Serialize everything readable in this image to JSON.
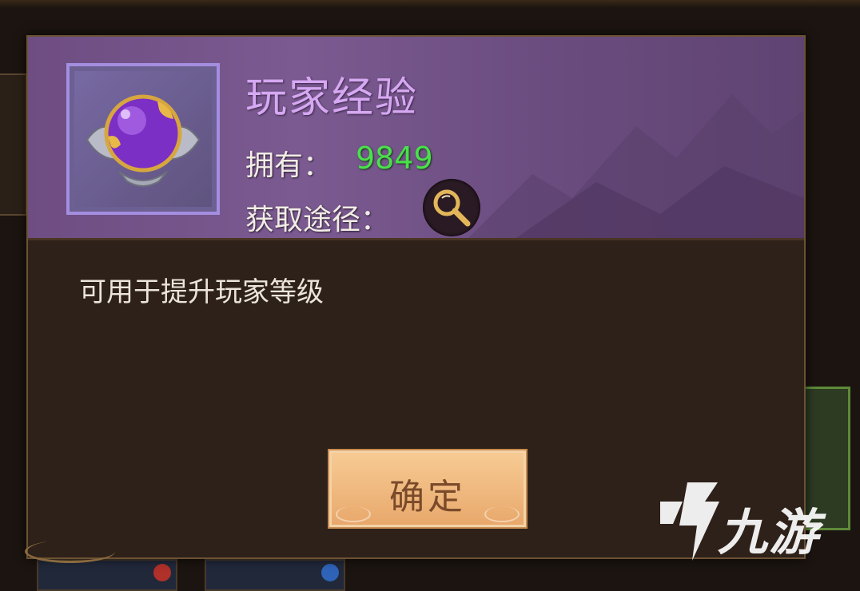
{
  "dialog": {
    "item_name": "玩家经验",
    "own_label": "拥有：",
    "own_value": "9849",
    "source_label": "获取途径：",
    "description": "可用于提升玩家等级",
    "confirm_label": "确定"
  },
  "watermark": {
    "text": "九游"
  },
  "icons": {
    "item": "purple-orb-icon",
    "source": "magnifier-icon"
  },
  "colors": {
    "item_name": "#d6a8f2",
    "own_value": "#49e14a",
    "header_bg": "#6e4d83",
    "panel_bg": "#2e2119",
    "confirm_bg": "#f0b97f"
  }
}
